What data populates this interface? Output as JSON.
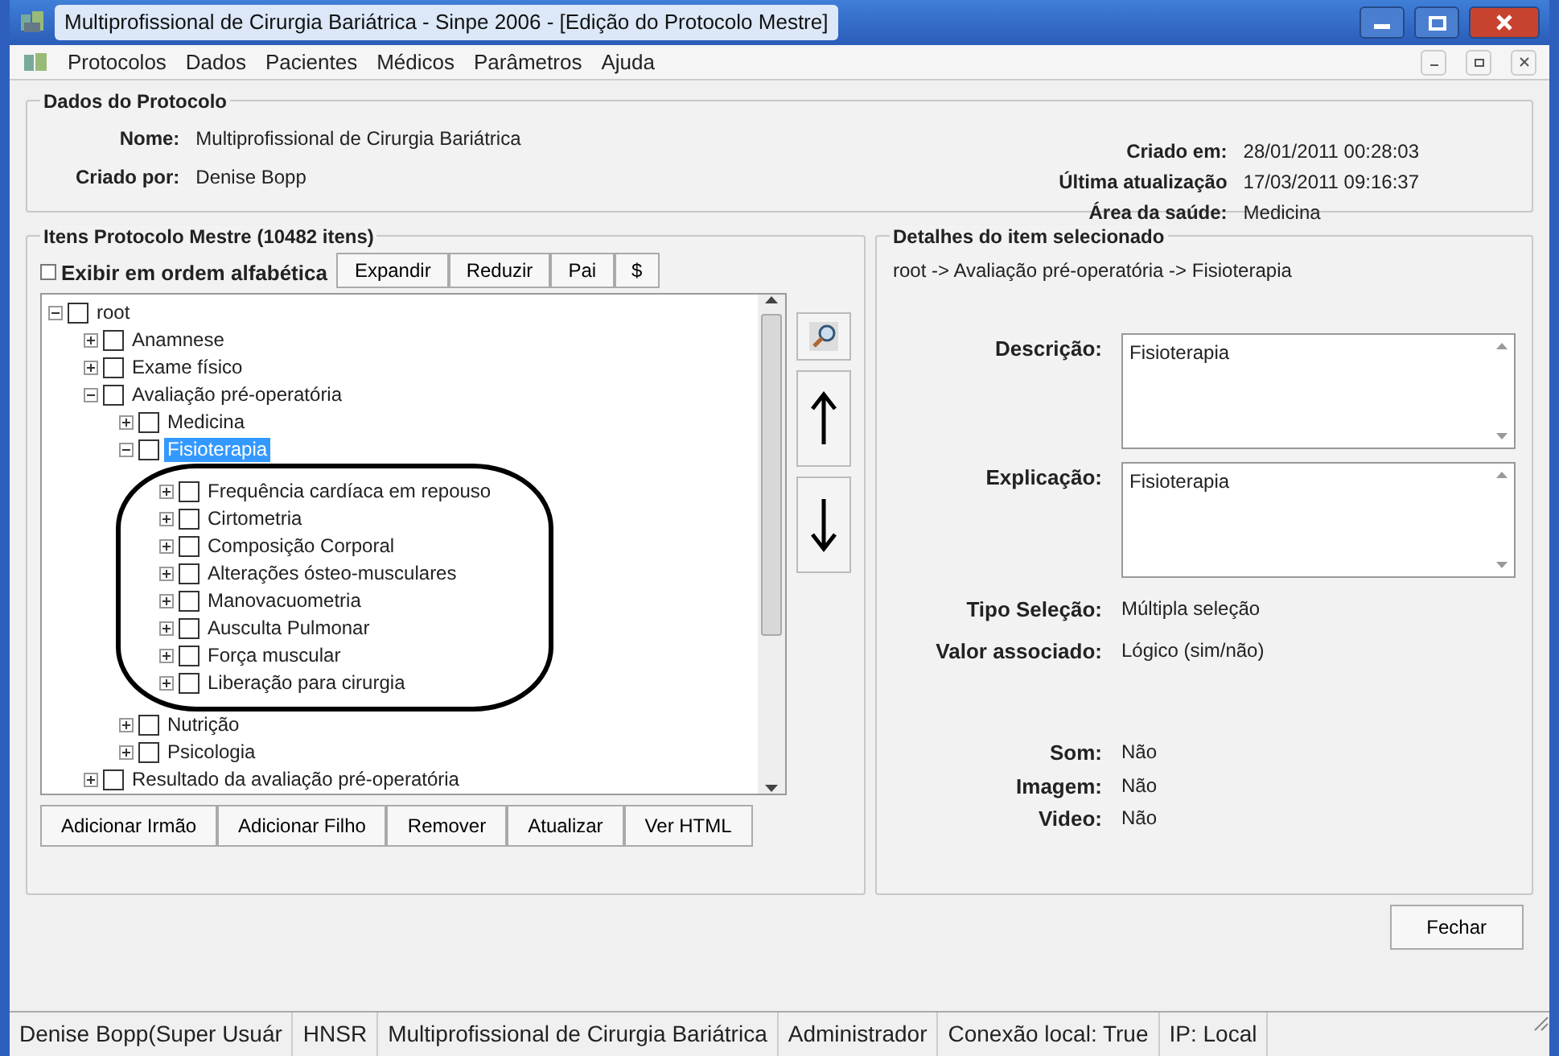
{
  "window": {
    "title": "Multiprofissional de Cirurgia Bariátrica - Sinpe 2006 - [Edição do Protocolo Mestre]"
  },
  "menu": [
    "Protocolos",
    "Dados",
    "Pacientes",
    "Médicos",
    "Parâmetros",
    "Ajuda"
  ],
  "protocol": {
    "legend": "Dados do Protocolo",
    "fields_left": [
      {
        "label": "Nome:",
        "value": "Multiprofissional de Cirurgia Bariátrica"
      },
      {
        "label": "Criado por:",
        "value": "Denise Bopp"
      }
    ],
    "fields_right": [
      {
        "label": "Criado em:",
        "value": "28/01/2011 00:28:03"
      },
      {
        "label": "Última atualização",
        "value": "17/03/2011 09:16:37"
      },
      {
        "label": "Área da saúde:",
        "value": "Medicina"
      }
    ]
  },
  "items_panel": {
    "legend": "Itens Protocolo Mestre (10482 itens)",
    "alphabetical": {
      "label": "Exibir em ordem alfabética",
      "checked": false
    },
    "toolbar": [
      "Expandir",
      "Reduzir",
      "Pai",
      "$"
    ],
    "tree": [
      {
        "label": "root",
        "expanded": true,
        "checked": false,
        "selected": false,
        "children": [
          {
            "label": "Anamnese",
            "expanded": false,
            "checked": false,
            "selected": false
          },
          {
            "label": "Exame físico",
            "expanded": false,
            "checked": false,
            "selected": false
          },
          {
            "label": "Avaliação pré-operatória",
            "expanded": true,
            "checked": false,
            "selected": false,
            "children": [
              {
                "label": "Medicina",
                "expanded": false,
                "checked": false,
                "selected": false
              },
              {
                "label": "Fisioterapia",
                "expanded": true,
                "checked": false,
                "selected": true,
                "circled": true,
                "children": [
                  {
                    "label": "Frequência cardíaca em repouso",
                    "expanded": false,
                    "checked": false,
                    "selected": false
                  },
                  {
                    "label": "Cirtometria",
                    "expanded": false,
                    "checked": false,
                    "selected": false
                  },
                  {
                    "label": "Composição Corporal",
                    "expanded": false,
                    "checked": false,
                    "selected": false
                  },
                  {
                    "label": "Alterações ósteo-musculares",
                    "expanded": false,
                    "checked": false,
                    "selected": false
                  },
                  {
                    "label": "Manovacuometria",
                    "expanded": false,
                    "checked": false,
                    "selected": false
                  },
                  {
                    "label": "Ausculta Pulmonar",
                    "expanded": false,
                    "checked": false,
                    "selected": false
                  },
                  {
                    "label": "Força muscular",
                    "expanded": false,
                    "checked": false,
                    "selected": false
                  },
                  {
                    "label": "Liberação para cirurgia",
                    "expanded": false,
                    "checked": false,
                    "selected": false
                  }
                ]
              },
              {
                "label": "Nutrição",
                "expanded": false,
                "checked": false,
                "selected": false
              },
              {
                "label": "Psicologia",
                "expanded": false,
                "checked": false,
                "selected": false
              }
            ]
          },
          {
            "label": "Resultado da avaliação pré-operatória",
            "expanded": false,
            "checked": false,
            "selected": false
          }
        ]
      }
    ],
    "buttons": [
      "Adicionar Irmão",
      "Adicionar Filho",
      "Remover",
      "Atualizar",
      "Ver HTML"
    ]
  },
  "details": {
    "legend": "Detalhes do item selecionado",
    "path": "root -> Avaliação pré-operatória -> Fisioterapia",
    "text_fields": [
      {
        "label": "Descrição:",
        "value": "Fisioterapia"
      },
      {
        "label": "Explicação:",
        "value": "Fisioterapia"
      }
    ],
    "fields": [
      {
        "label": "Tipo Seleção:",
        "value": "Múltipla seleção"
      },
      {
        "label": "Valor associado:",
        "value": "Lógico (sim/não)"
      }
    ],
    "media": [
      {
        "label": "Som:",
        "value": "Não"
      },
      {
        "label": "Imagem:",
        "value": "Não"
      },
      {
        "label": "Video:",
        "value": "Não"
      }
    ]
  },
  "close_button": "Fechar",
  "status_bar": [
    "Denise Bopp(Super Usuár",
    "HNSR",
    "Multiprofissional de Cirurgia Bariátrica",
    "Administrador",
    "Conexão local: True",
    "IP: Local"
  ]
}
